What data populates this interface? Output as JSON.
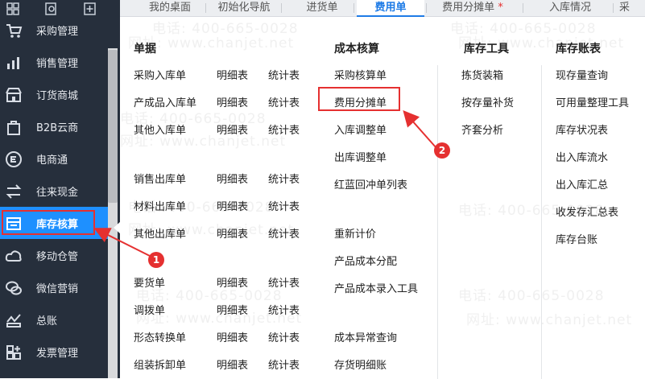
{
  "tabs": [
    {
      "label": "我的桌面"
    },
    {
      "label": "初始化导航"
    },
    {
      "label": "进货单"
    },
    {
      "label": "费用单"
    },
    {
      "label": "费用分摊单",
      "dot": "*"
    },
    {
      "label": "入库情况"
    },
    {
      "label": "采"
    }
  ],
  "sidebar": {
    "items": [
      {
        "label": "采购管理",
        "icon": "cart-icon"
      },
      {
        "label": "销售管理",
        "icon": "bar-chart-icon"
      },
      {
        "label": "订货商城",
        "icon": "store-icon"
      },
      {
        "label": "B2B云商",
        "icon": "bag-icon"
      },
      {
        "label": "电商通",
        "icon": "e-circle-icon"
      },
      {
        "label": "往来现金",
        "icon": "exchange-icon"
      },
      {
        "label": "库存核算",
        "icon": "inventory-icon",
        "active": true
      },
      {
        "label": "移动仓管",
        "icon": "cloud-warehouse-icon"
      },
      {
        "label": "微信营销",
        "icon": "wechat-icon"
      },
      {
        "label": "总账",
        "icon": "ledger-icon"
      },
      {
        "label": "发票管理",
        "icon": "invoice-icon"
      }
    ]
  },
  "menu": {
    "col1": {
      "title": "单据",
      "rows": [
        {
          "doc": "采购入库单",
          "detail": "明细表",
          "stats": "统计表"
        },
        {
          "doc": "产成品入库单",
          "detail": "明细表",
          "stats": "统计表"
        },
        {
          "doc": "其他入库单",
          "detail": "明细表",
          "stats": "统计表"
        },
        {
          "doc": "销售出库单",
          "detail": "明细表",
          "stats": "统计表"
        },
        {
          "doc": "材料出库单",
          "detail": "明细表",
          "stats": "统计表"
        },
        {
          "doc": "其他出库单",
          "detail": "明细表",
          "stats": "统计表"
        },
        {
          "doc": "要货单",
          "detail": "明细表",
          "stats": "统计表"
        },
        {
          "doc": "调拨单",
          "detail": "明细表",
          "stats": "统计表"
        },
        {
          "doc": "形态转换单",
          "detail": "明细表",
          "stats": "统计表"
        },
        {
          "doc": "组装拆卸单",
          "detail": "明细表",
          "stats": "统计表"
        }
      ]
    },
    "col2": {
      "title": "成本核算",
      "items": [
        "采购核算单",
        "费用分摊单",
        "入库调整单",
        "出库调整单",
        "红蓝回冲单列表",
        "重新计价",
        "产品成本分配",
        "产品成本录入工具",
        "成本异常查询",
        "存货明细账"
      ]
    },
    "col3": {
      "title": "库存工具",
      "items": [
        "拣货装箱",
        "按存量补货",
        "齐套分析"
      ]
    },
    "col4": {
      "title": "库存账表",
      "items": [
        "现存量查询",
        "可用量整理工具",
        "库存状况表",
        "出入库流水",
        "出入库汇总",
        "收发存汇总表",
        "库存台账"
      ]
    }
  },
  "annotations": {
    "badge1": "1",
    "badge2": "2"
  },
  "watermark": {
    "phone": "电话: 400-665-0028",
    "site": "网址: www.chanjet.net"
  },
  "colors": {
    "sidebar_bg": "#262f3c",
    "active_blue": "#1e90ff",
    "accent_red": "#e53030",
    "tab_active": "#1e7be6"
  }
}
